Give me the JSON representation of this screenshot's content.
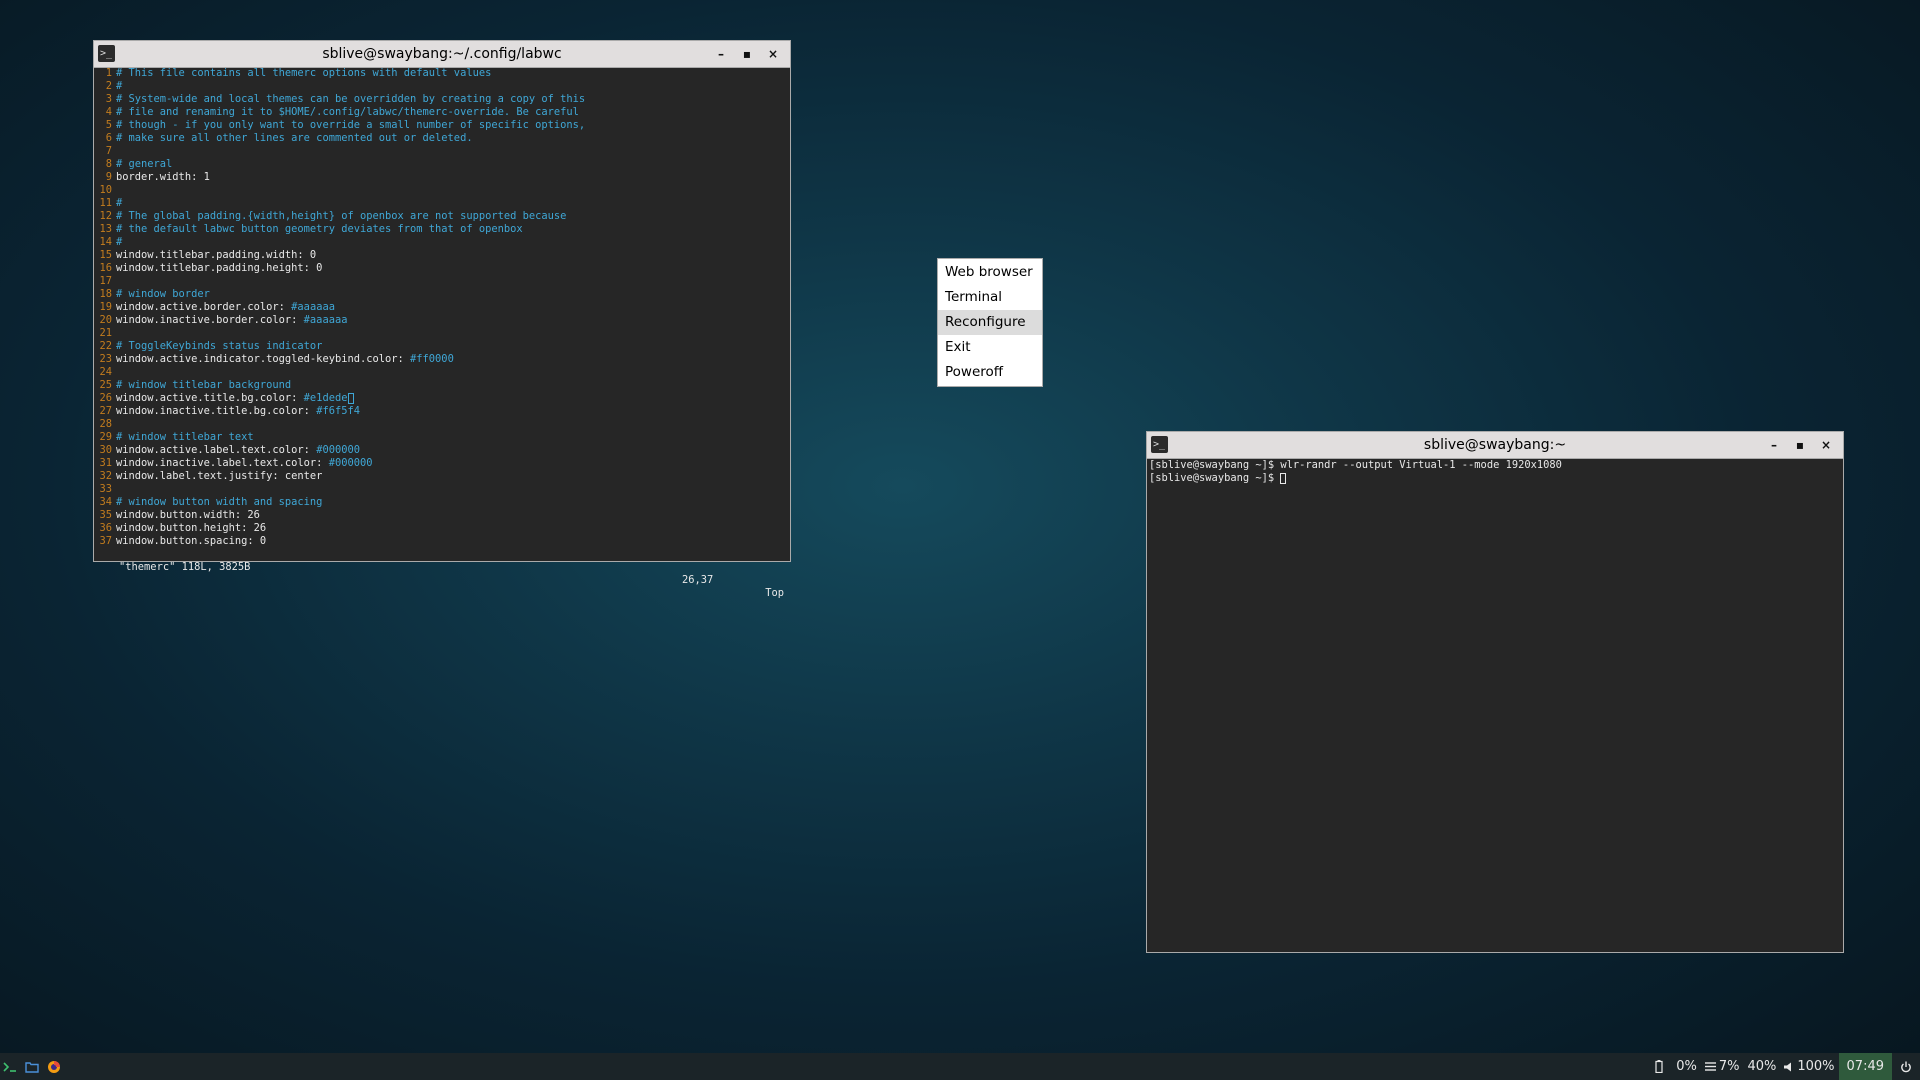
{
  "editor_window": {
    "title": "sblive@swaybang:~/.config/labwc",
    "buttons": {
      "minimize": "–",
      "maximize": "▪",
      "close": "×"
    },
    "lines": [
      {
        "n": "1",
        "code": "",
        "comment": "# This file contains all themerc options with default values"
      },
      {
        "n": "2",
        "code": "",
        "comment": "#"
      },
      {
        "n": "3",
        "code": "",
        "comment": "# System-wide and local themes can be overridden by creating a copy of this"
      },
      {
        "n": "4",
        "code": "",
        "comment": "# file and renaming it to $HOME/.config/labwc/themerc-override. Be careful"
      },
      {
        "n": "5",
        "code": "",
        "comment": "# though - if you only want to override a small number of specific options,"
      },
      {
        "n": "6",
        "code": "",
        "comment": "# make sure all other lines are commented out or deleted."
      },
      {
        "n": "7",
        "code": "",
        "comment": ""
      },
      {
        "n": "8",
        "code": "",
        "comment": "# general"
      },
      {
        "n": "9",
        "code": "border.width: 1",
        "comment": ""
      },
      {
        "n": "10",
        "code": "",
        "comment": ""
      },
      {
        "n": "11",
        "code": "",
        "comment": "#"
      },
      {
        "n": "12",
        "code": "",
        "comment": "# The global padding.{width,height} of openbox are not supported because"
      },
      {
        "n": "13",
        "code": "",
        "comment": "# the default labwc button geometry deviates from that of openbox"
      },
      {
        "n": "14",
        "code": "",
        "comment": "#"
      },
      {
        "n": "15",
        "code": "window.titlebar.padding.width: 0",
        "comment": ""
      },
      {
        "n": "16",
        "code": "window.titlebar.padding.height: 0",
        "comment": ""
      },
      {
        "n": "17",
        "code": "",
        "comment": ""
      },
      {
        "n": "18",
        "code": "",
        "comment": "# window border"
      },
      {
        "n": "19",
        "code": "window.active.border.color: ",
        "comment": "#aaaaaa"
      },
      {
        "n": "20",
        "code": "window.inactive.border.color: ",
        "comment": "#aaaaaa"
      },
      {
        "n": "21",
        "code": "",
        "comment": ""
      },
      {
        "n": "22",
        "code": "",
        "comment": "# ToggleKeybinds status indicator"
      },
      {
        "n": "23",
        "code": "window.active.indicator.toggled-keybind.color: ",
        "comment": "#ff0000"
      },
      {
        "n": "24",
        "code": "",
        "comment": ""
      },
      {
        "n": "25",
        "code": "",
        "comment": "# window titlebar background"
      },
      {
        "n": "26",
        "code": "window.active.title.bg.color: ",
        "comment": "#e1dede",
        "cursor": true
      },
      {
        "n": "27",
        "code": "window.inactive.title.bg.color: ",
        "comment": "#f6f5f4"
      },
      {
        "n": "28",
        "code": "",
        "comment": ""
      },
      {
        "n": "29",
        "code": "",
        "comment": "# window titlebar text"
      },
      {
        "n": "30",
        "code": "window.active.label.text.color: ",
        "comment": "#000000"
      },
      {
        "n": "31",
        "code": "window.inactive.label.text.color: ",
        "comment": "#000000"
      },
      {
        "n": "32",
        "code": "window.label.text.justify: center",
        "comment": ""
      },
      {
        "n": "33",
        "code": "",
        "comment": ""
      },
      {
        "n": "34",
        "code": "",
        "comment": "# window button width and spacing"
      },
      {
        "n": "35",
        "code": "window.button.width: 26",
        "comment": ""
      },
      {
        "n": "36",
        "code": "window.button.height: 26",
        "comment": ""
      },
      {
        "n": "37",
        "code": "window.button.spacing: 0",
        "comment": ""
      }
    ],
    "status": {
      "file": "\"themerc\" 118L, 3825B",
      "position": "26,37",
      "scroll": "Top"
    }
  },
  "context_menu": {
    "items": [
      "Web browser",
      "Terminal",
      "Reconfigure",
      "Exit",
      "Poweroff"
    ],
    "highlighted": "Reconfigure"
  },
  "terminal_window": {
    "title": "sblive@swaybang:~",
    "buttons": {
      "minimize": "–",
      "maximize": "▪",
      "close": "×"
    },
    "line1_prompt": "[sblive@swaybang ~]$ ",
    "line1_cmd": "wlr-randr --output Virtual-1 --mode 1920x1080",
    "line2_prompt": "[sblive@swaybang ~]$ "
  },
  "taskbar": {
    "launchers": [
      "terminal-launcher",
      "files-launcher",
      "firefox-launcher"
    ],
    "battery_text": "0%",
    "cpu_text": "7%",
    "memory_text": "40%",
    "volume_text": "100%",
    "clock": "07:49"
  },
  "colors": {
    "titlebar_active": "#e1dede",
    "comment": "#3fa7d6",
    "line_number": "#c47d1e",
    "clock_bg": "#2f5a3c"
  }
}
